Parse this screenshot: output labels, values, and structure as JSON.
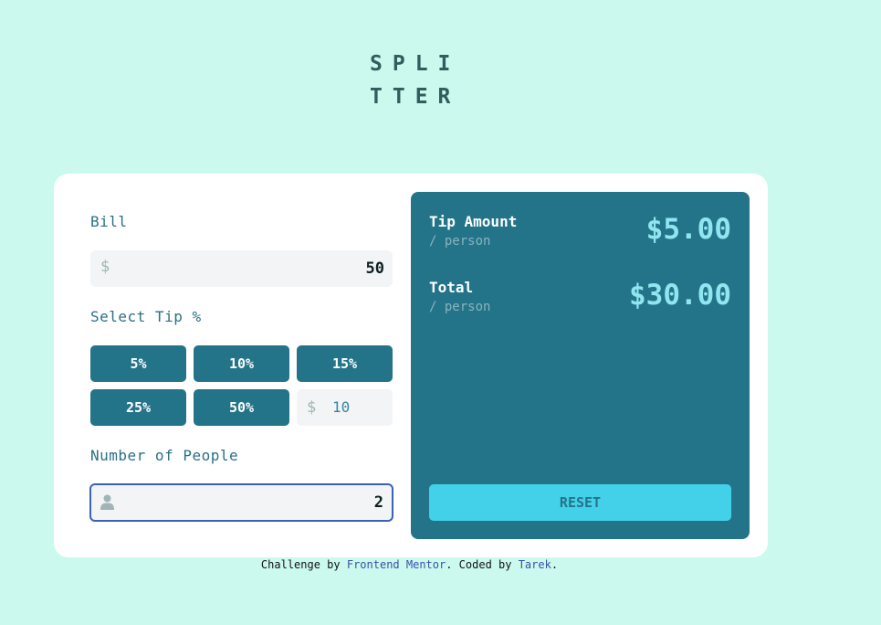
{
  "logo": {
    "line1": "SPLI",
    "line2": "TTER"
  },
  "bill": {
    "label": "Bill",
    "currency": "$",
    "value": "50"
  },
  "tip": {
    "label": "Select Tip %",
    "options": [
      "5%",
      "10%",
      "15%",
      "25%",
      "50%"
    ],
    "custom_currency": "$",
    "custom_value": "10"
  },
  "people": {
    "label": "Number of People",
    "value": "2"
  },
  "result": {
    "tip_title": "Tip Amount",
    "tip_sub": "/ person",
    "tip_value": "$5.00",
    "total_title": "Total",
    "total_sub": "/ person",
    "total_value": "$30.00",
    "reset_label": "RESET"
  },
  "footer": {
    "prefix": "Challenge by ",
    "link1": "Frontend Mentor",
    "middle": ". Coded by ",
    "link2": "Tarek",
    "suffix": "."
  },
  "colors": {
    "background": "#cbf9ee",
    "primary": "#247489",
    "accent": "#43d1ea",
    "amount": "#8fe6f0"
  }
}
